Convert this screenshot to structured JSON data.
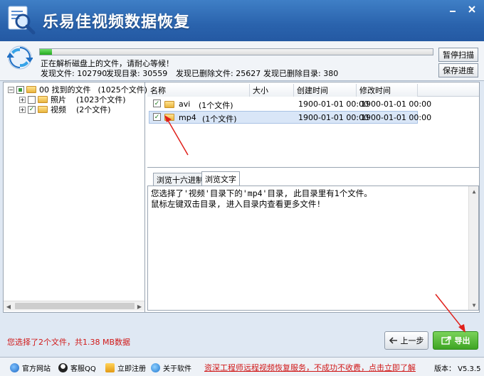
{
  "app": {
    "title": "乐易佳视频数据恢复"
  },
  "window": {
    "minimize_icon": "minimize-icon",
    "close_icon": "close-icon"
  },
  "scan": {
    "progress_fraction": 0.03,
    "status_text": "正在解析磁盘上的文件，请耐心等候！",
    "found_files": "发现文件: 102790",
    "found_dirs": "发现目录: 30559",
    "deleted_files": "发现已删除文件: 25627",
    "deleted_dirs": "发现已删除目录: 380",
    "pause_label": "暂停扫描",
    "save_label": "保存进度"
  },
  "tree": {
    "root": {
      "label": "00 找到的文件",
      "count": "(1025个文件)"
    },
    "children": [
      {
        "label": "照片",
        "count": "(1023个文件)",
        "checked": false
      },
      {
        "label": "视频",
        "count": "(2个文件)",
        "checked": true
      }
    ]
  },
  "file_list": {
    "columns": [
      "名称",
      "大小",
      "创建时间",
      "修改时间"
    ],
    "rows": [
      {
        "name": "avi",
        "count": "(1个文件)",
        "created": "1900-01-01 00:00",
        "modified": "1900-01-01 00:00",
        "checked": true,
        "selected": false
      },
      {
        "name": "mp4",
        "count": "(1个文件)",
        "created": "1900-01-01 00:00",
        "modified": "1900-01-01 00:00",
        "checked": true,
        "selected": true
      }
    ]
  },
  "preview": {
    "tabs": [
      "浏览十六进制",
      "浏览文字"
    ],
    "active_tab": 1,
    "lines": [
      "您选择了'视频'目录下的'mp4'目录, 此目录里有1个文件。",
      "鼠标左键双击目录, 进入目录内查看更多文件!"
    ]
  },
  "bottom": {
    "selection_note": "您选择了2个文件，共1.38 MB数据",
    "prev_label": "上一步",
    "export_label": "导出"
  },
  "footer": {
    "items": [
      "官方网站",
      "客服QQ",
      "立即注册",
      "关于软件"
    ],
    "promo": "资深工程师远程视频恢复服务，不成功不收费，点击立即了解",
    "version": "版本： V5.3.5"
  },
  "colors": {
    "accent": "#2a63ad",
    "export": "#3ea424",
    "alert": "#d01818"
  }
}
